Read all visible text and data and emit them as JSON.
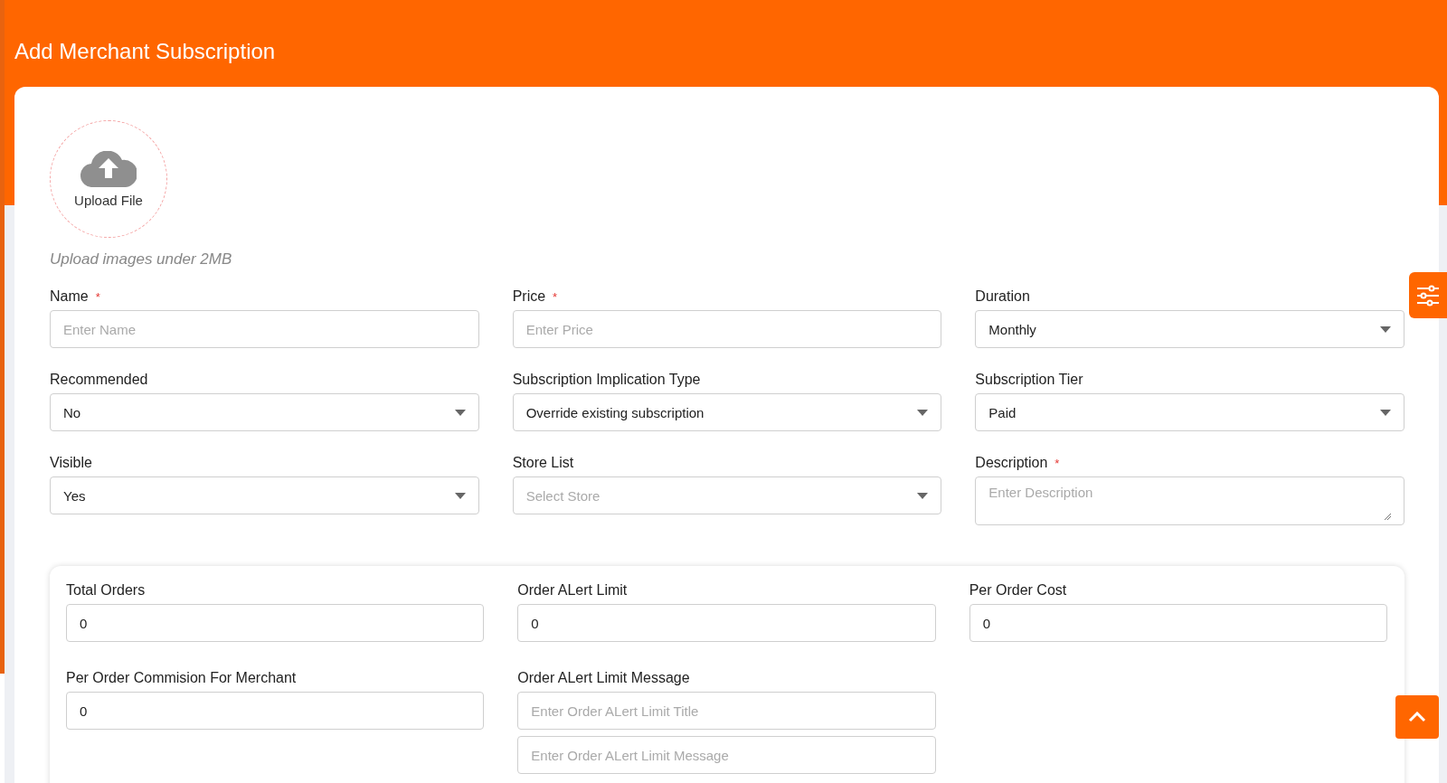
{
  "page_title": "Add Merchant Subscription",
  "upload": {
    "label": "Upload File",
    "hint": "Upload images under 2MB"
  },
  "fields": [
    {
      "label": "Name",
      "required_mark": "*",
      "kind": "text",
      "placeholder": "Enter Name"
    },
    {
      "label": "Price",
      "required_mark": "*",
      "kind": "text",
      "placeholder": "Enter Price"
    },
    {
      "label": "Duration",
      "kind": "select",
      "value": "Monthly"
    },
    {
      "label": "Recommended",
      "kind": "select",
      "value": "No"
    },
    {
      "label": "Subscription Implication Type",
      "kind": "select",
      "value": "Override existing subscription"
    },
    {
      "label": "Subscription Tier",
      "kind": "select",
      "value": "Paid"
    },
    {
      "label": "Visible",
      "kind": "select",
      "value": "Yes"
    },
    {
      "label": "Store List",
      "kind": "select",
      "placeholder": "Select Store"
    },
    {
      "label": "Description",
      "required_mark": "*",
      "kind": "textarea",
      "placeholder": "Enter Description"
    }
  ],
  "order_fields": [
    {
      "label": "Total Orders",
      "inputs": [
        {
          "value": "0"
        }
      ]
    },
    {
      "label": "Order ALert Limit",
      "inputs": [
        {
          "value": "0"
        }
      ]
    },
    {
      "label": "Per Order Cost",
      "inputs": [
        {
          "value": "0"
        }
      ]
    },
    {
      "label": "Per Order Commision For Merchant",
      "inputs": [
        {
          "value": "0"
        }
      ]
    },
    {
      "label": "Order ALert Limit Message",
      "inputs": [
        {
          "placeholder": "Enter Order ALert Limit Title"
        },
        {
          "placeholder": "Enter Order ALert Limit Message"
        }
      ]
    }
  ]
}
